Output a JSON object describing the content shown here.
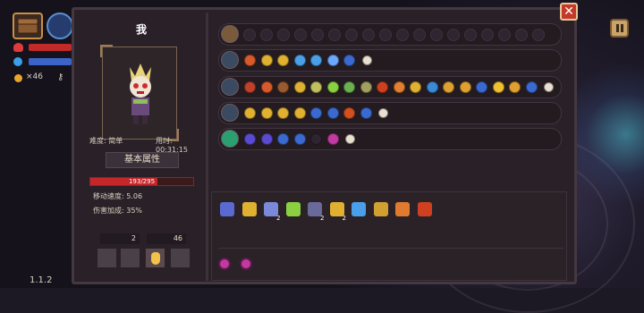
{
  "hud": {
    "coins": "×46",
    "version": "1.1.2",
    "colors": {
      "hp": "#e03a3a",
      "shield": "#3aa0e8"
    }
  },
  "character": {
    "name": "我",
    "difficulty": "难度: 简单",
    "time": "用时: 00:31:15",
    "attributes_button": "基本属性",
    "hp": "193/295",
    "hp_fraction": 0.654,
    "move_speed": "移动速度: 5.06",
    "damage_bonus": "伤害加成: 35%",
    "keys": "2",
    "coins": "46"
  },
  "inventory": {
    "items": [
      {
        "icon": "rune-tablet-icon",
        "count": ""
      },
      {
        "icon": "crown-icon",
        "count": ""
      },
      {
        "icon": "egg-icon",
        "count": "2"
      },
      {
        "icon": "herb-icon",
        "count": ""
      },
      {
        "icon": "bell-icon",
        "count": "2"
      },
      {
        "icon": "teeth-icon",
        "count": "2"
      },
      {
        "icon": "potion-icon",
        "count": ""
      },
      {
        "icon": "map-icon",
        "count": ""
      },
      {
        "icon": "lantern-icon",
        "count": ""
      },
      {
        "icon": "scroll-icon",
        "count": ""
      }
    ]
  },
  "controls": {
    "close": "✕"
  }
}
